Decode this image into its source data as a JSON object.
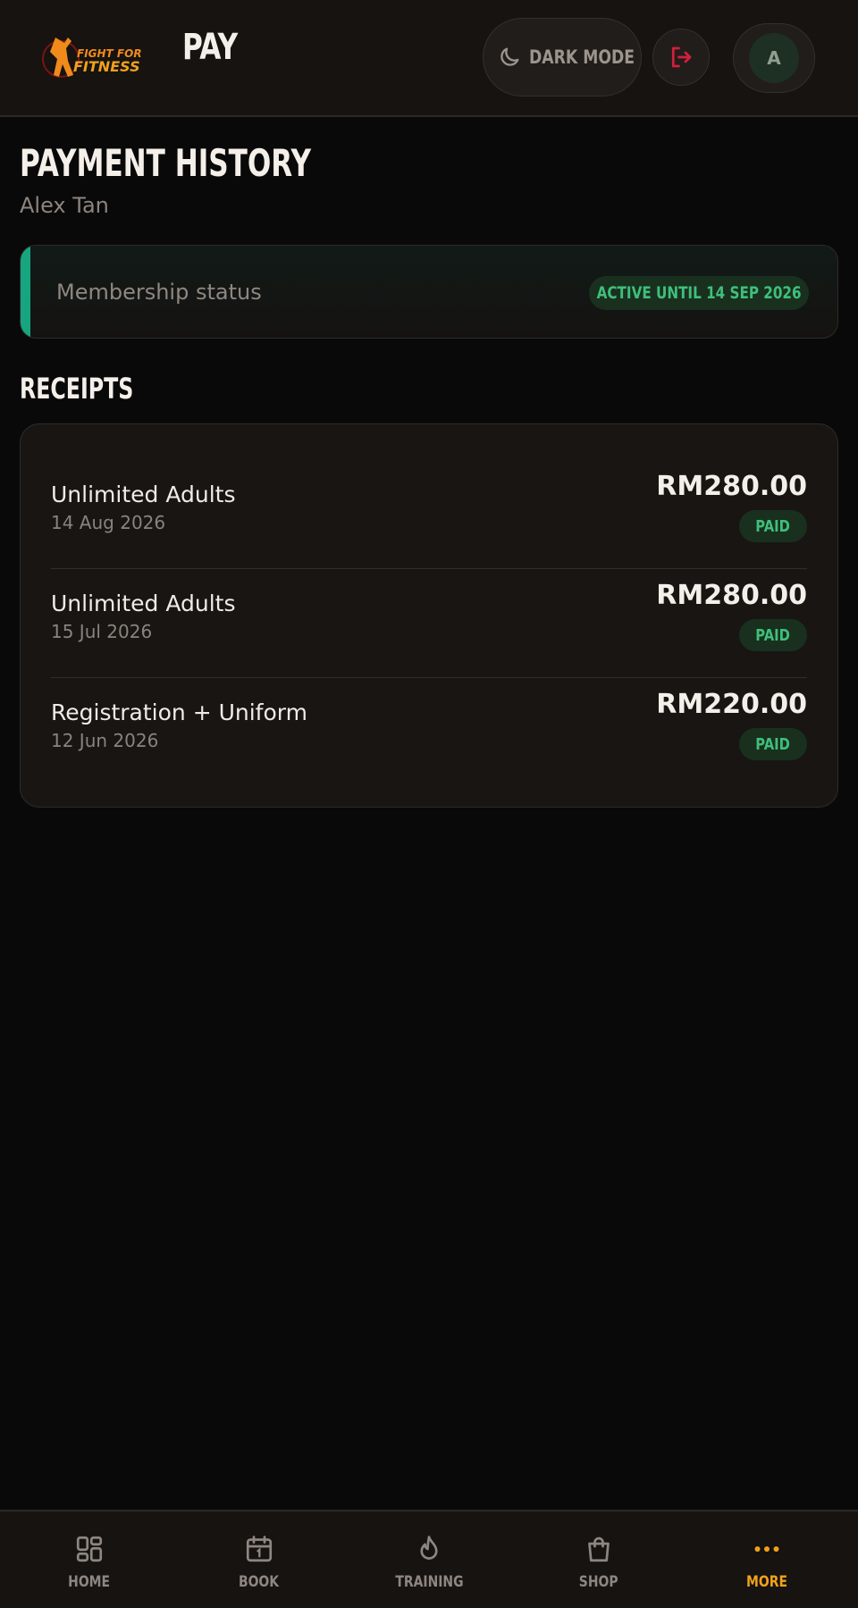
{
  "header": {
    "title": "PAY",
    "logo_text": [
      "FIGHT FOR",
      "FITNESS"
    ],
    "dark_mode_label": "DARK MODE",
    "avatar_initial": "A"
  },
  "page": {
    "heading": "PAYMENT HISTORY",
    "member_name": "Alex Tan"
  },
  "membership": {
    "label": "Membership status",
    "badge": "ACTIVE UNTIL 14 SEP 2026"
  },
  "receipts": {
    "heading": "RECEIPTS",
    "items": [
      {
        "title": "Unlimited Adults",
        "date": "14 Aug 2026",
        "amount": "RM280.00",
        "status": "PAID"
      },
      {
        "title": "Unlimited Adults",
        "date": "15 Jul 2026",
        "amount": "RM280.00",
        "status": "PAID"
      },
      {
        "title": "Registration + Uniform",
        "date": "12 Jun 2026",
        "amount": "RM220.00",
        "status": "PAID"
      }
    ]
  },
  "nav": {
    "items": [
      {
        "label": "HOME",
        "icon": "grid-icon",
        "active": false
      },
      {
        "label": "BOOK",
        "icon": "calendar-icon",
        "active": false
      },
      {
        "label": "TRAINING",
        "icon": "flame-icon",
        "active": false
      },
      {
        "label": "SHOP",
        "icon": "shopping-bag-icon",
        "active": false
      },
      {
        "label": "MORE",
        "icon": "ellipsis-icon",
        "active": true
      }
    ]
  },
  "colors": {
    "background": "#0a0909",
    "surface": "#181513",
    "accent_green": "#3fbf7b",
    "accent_teal": "#17a57f",
    "accent_orange": "#f0a11c",
    "logout_red": "#d11f3c"
  }
}
